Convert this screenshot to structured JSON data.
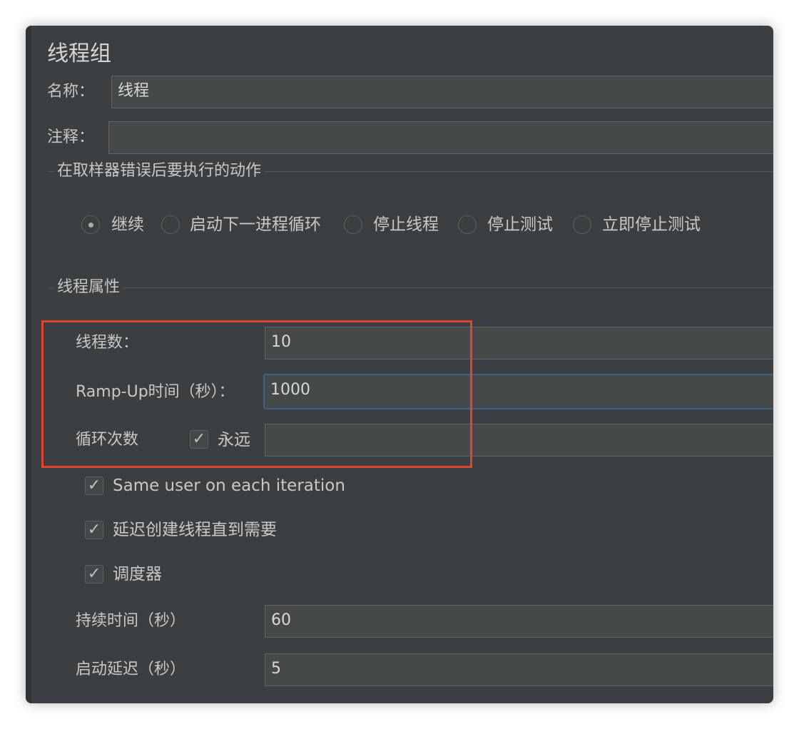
{
  "title": "线程组",
  "name_label": "名称：",
  "name_value": "线程",
  "comment_label": "注释：",
  "comment_value": "",
  "sampler_error_section": {
    "title": "在取样器错误后要执行的动作",
    "options": [
      "继续",
      "启动下一进程循环",
      "停止线程",
      "停止测试",
      "立即停止测试"
    ],
    "selected": "继续"
  },
  "thread_props_section": {
    "title": "线程属性",
    "num_threads_label": "线程数：",
    "num_threads_value": "10",
    "ramp_up_label": "Ramp-Up时间（秒）：",
    "ramp_up_value": "1000",
    "loop_label": "循环次数",
    "forever_label": "永远",
    "forever_checked": true,
    "loop_value": ""
  },
  "checkboxes": {
    "same_user_label": "Same user on each iteration",
    "same_user_checked": true,
    "delay_create_label": "延迟创建线程直到需要",
    "delay_create_checked": true,
    "scheduler_label": "调度器",
    "scheduler_checked": true
  },
  "scheduler": {
    "duration_label": "持续时间（秒）",
    "duration_value": "60",
    "startup_delay_label": "启动延迟（秒）",
    "startup_delay_value": "5"
  },
  "colors": {
    "panel_bg": "#3c3f41",
    "field_bg": "#45494a",
    "focus_border": "#3d6185",
    "highlight": "#e2452d"
  },
  "icons": {
    "check": "✓"
  }
}
